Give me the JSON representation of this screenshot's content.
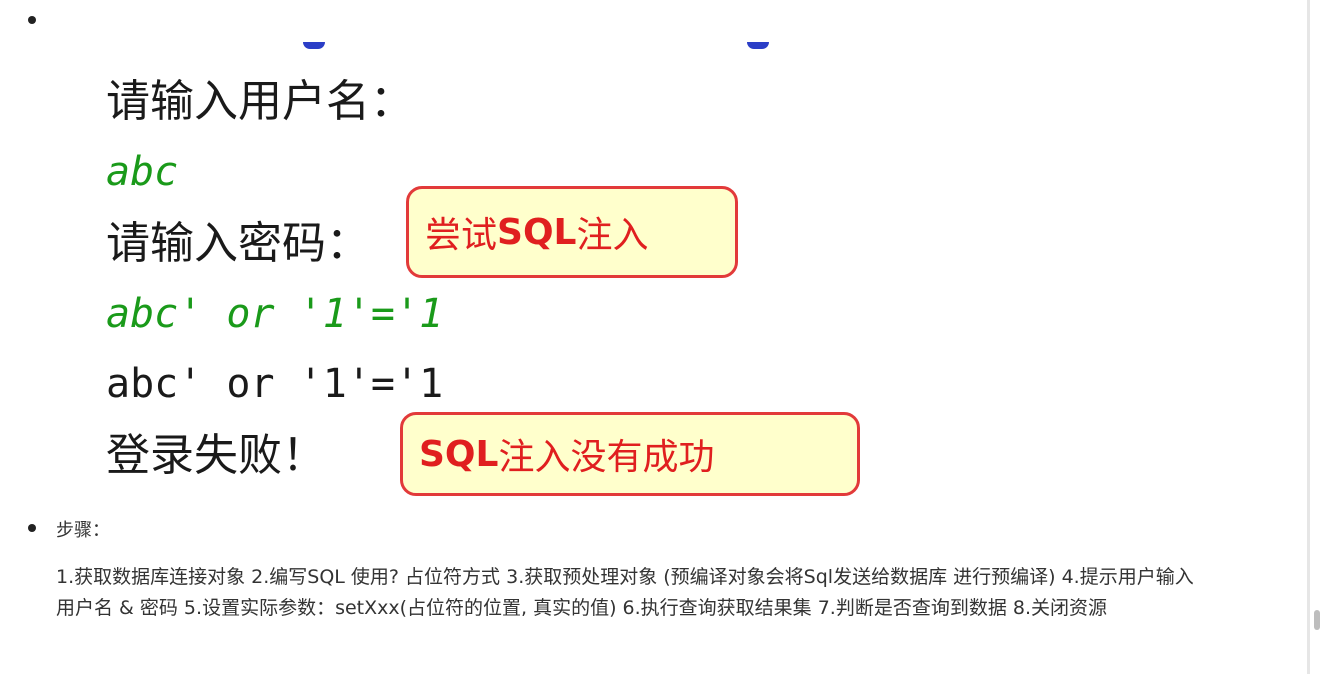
{
  "image": {
    "prompt_username": "请输入用户名：",
    "username_value": "abc",
    "prompt_password": "请输入密码：",
    "password_value": "abc' or '1'='1",
    "echo_value": "abc' or '1'='1",
    "result": "登录失败！",
    "callout_try": {
      "prefix": "尝试",
      "bold": "SQL",
      "suffix": "注入"
    },
    "callout_fail": {
      "bold": "SQL",
      "suffix": "注入没有成功"
    }
  },
  "steps": {
    "label": "步骤：",
    "text": "1.获取数据库连接对象 2.编写SQL 使用? 占位符方式 3.获取预处理对象 (预编译对象会将Sql发送给数据库 进行预编译) 4.提示用户输入用户名 & 密码 5.设置实际参数：setXxx(占位符的位置, 真实的值) 6.执行查询获取结果集 7.判断是否查询到数据 8.关闭资源"
  },
  "colors": {
    "callout_border": "#e23a3a",
    "callout_fill": "#ffffcc",
    "callout_text": "#e01f1f",
    "input_green": "#1a9a1a"
  }
}
